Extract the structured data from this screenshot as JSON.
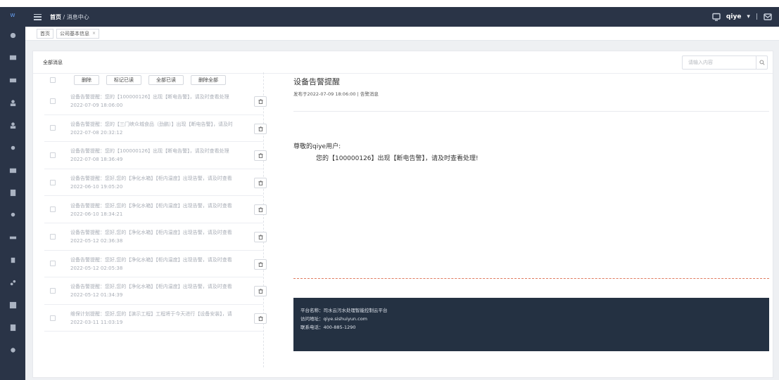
{
  "topbar": {
    "crumb_home": "首页",
    "crumb_sep": "/",
    "crumb_current": "消息中心",
    "user_name": "qiye",
    "user_caret": "▾",
    "sep": "|"
  },
  "tabs": [
    {
      "label": "首页"
    },
    {
      "label": "公司基本信息",
      "close": "×"
    }
  ],
  "card": {
    "title": "全部消息",
    "search_placeholder": "请输入内容"
  },
  "toolbar": {
    "delete": "删除",
    "mark_read": "标记已读",
    "all_read": "全部已读",
    "delete_all": "删除全部"
  },
  "messages": [
    {
      "title": "设备告警提醒：您的【100000126】出现【断电告警】，请及时查看处理",
      "time": "2022-07-09 18:06:00"
    },
    {
      "title": "设备告警提醒：您的【三门峡众城食品（劲鹏）】出现【断电告警】，请及时查看处理",
      "time": "2022-07-08 20:32:12"
    },
    {
      "title": "设备告警提醒：您的【100000126】出现【断电告警】，请及时查看处理",
      "time": "2022-07-08 18:36:49"
    },
    {
      "title": "设备告警提醒：您好,您的【净化水箱】【柜内温度】出现告警，请及时查看处理",
      "time": "2022-06-10 19:05:20"
    },
    {
      "title": "设备告警提醒：您好,您的【净化水箱】【柜内温度】出现告警，请及时查看处理",
      "time": "2022-06-10 18:34:21"
    },
    {
      "title": "设备告警提醒：您好,您的【净化水箱】【柜内温度】出现告警，请及时查看处理",
      "time": "2022-05-12 02:36:38"
    },
    {
      "title": "设备告警提醒：您好,您的【净化水箱】【柜内温度】出现告警，请及时查看处理",
      "time": "2022-05-12 02:05:38"
    },
    {
      "title": "设备告警提醒：您好,您的【净化水箱】【柜内温度】出现告警，请及时查看处理",
      "time": "2022-05-12 01:34:39"
    },
    {
      "title": "维保计划提醒：您好,您的【演示工程】工程将于今天进行【设备安装】，请及时处理",
      "time": "2022-03-11 11:03:19"
    }
  ],
  "detail": {
    "title": "设备告警提醒",
    "meta": "发布于2022-07-09 18:06:00 | 告警消息",
    "greeting": "尊敬的qiye用户:",
    "body": "您的【100000126】出现【断电告警】，请及时查看处理!",
    "footer": {
      "platform": "平台名称：司水云污水处理智能控制云平台",
      "url": "访问地址：qiye.sishuiyun.com",
      "phone": "联系电话：400-885-1290"
    }
  }
}
